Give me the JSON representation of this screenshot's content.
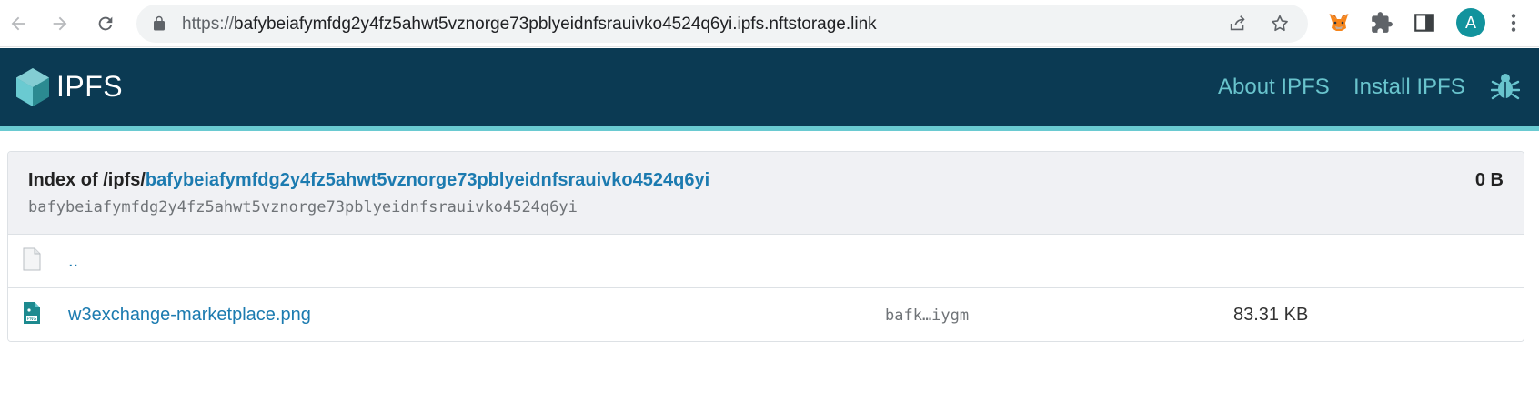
{
  "browser": {
    "url_prefix": "https://",
    "url_host": "bafybeiafymfdg2y4fz5ahwt5vznorge73pblyeidnfsrauivko4524q6yi.ipfs.nftstorage.link",
    "avatar_letter": "A",
    "icons": [
      "back-icon",
      "forward-icon",
      "reload-icon",
      "lock-icon",
      "share-icon",
      "star-icon",
      "metamask-fox-icon",
      "puzzle-extensions-icon",
      "side-panel-icon",
      "kebab-menu-icon"
    ]
  },
  "header": {
    "brand": "IPFS",
    "links": [
      "About IPFS",
      "Install IPFS"
    ],
    "accent_color": "#6acad1",
    "background_color": "#0b3a53"
  },
  "listing": {
    "index_prefix": "Index of /ipfs/",
    "cid": "bafybeiafymfdg2y4fz5ahwt5vznorge73pblyeidnfsrauivko4524q6yi",
    "cid_plain": "bafybeiafymfdg2y4fz5ahwt5vznorge73pblyeidnfsrauivko4524q6yi",
    "total_size": "0 B",
    "rows": [
      {
        "icon": "blank-file-icon",
        "name": "..",
        "cid": "",
        "size": ""
      },
      {
        "icon": "png-file-icon",
        "name": "w3exchange-marketplace.png",
        "cid": "bafk…iygm",
        "size": "83.31 KB"
      }
    ]
  }
}
